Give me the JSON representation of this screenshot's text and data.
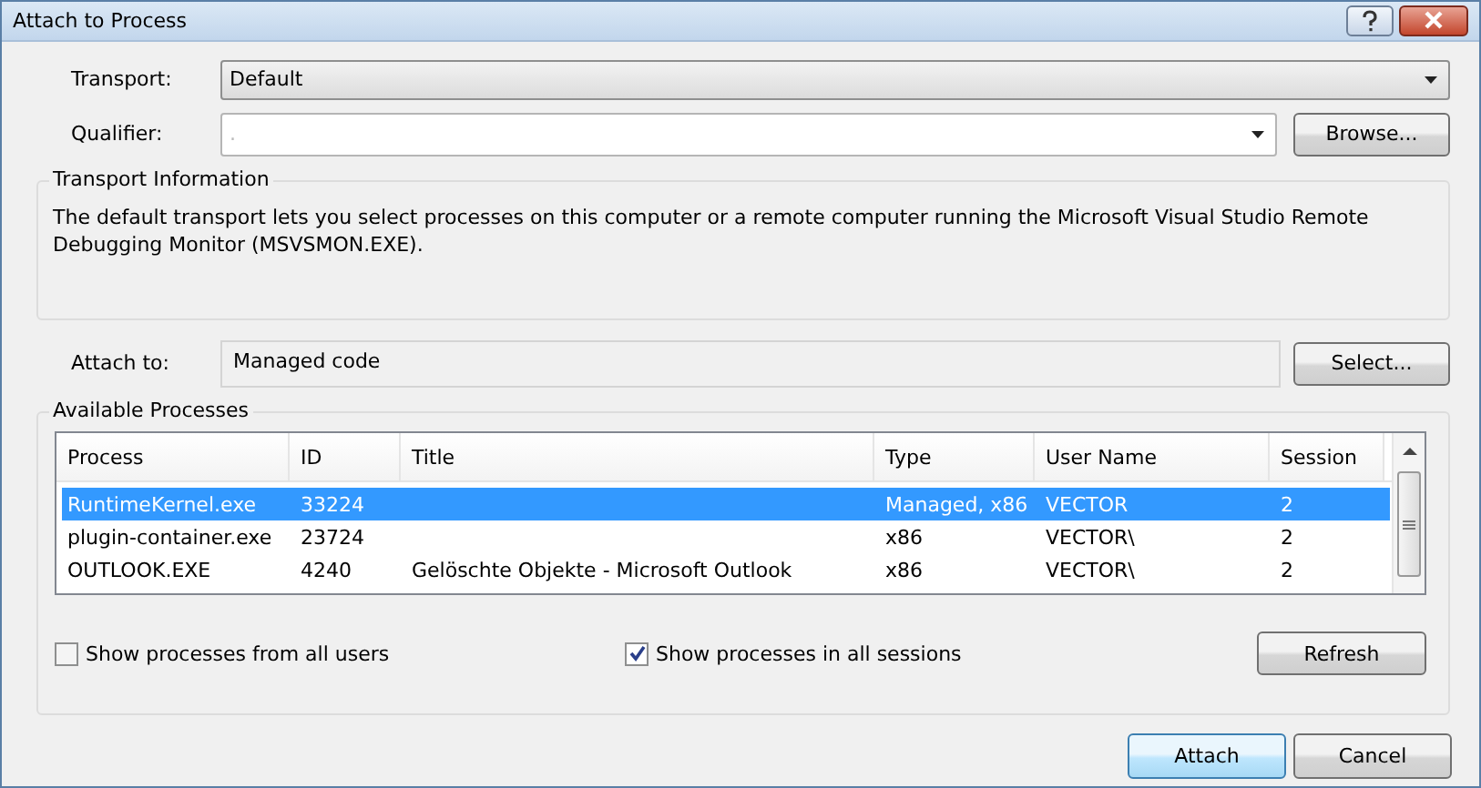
{
  "window": {
    "title": "Attach to Process"
  },
  "transport": {
    "label": "Transport:",
    "value": "Default"
  },
  "qualifier": {
    "label": "Qualifier:",
    "value": ".",
    "button": "Browse..."
  },
  "transport_information": {
    "title": "Transport Information",
    "text": "The default transport lets you select processes on this computer or a remote computer running the Microsoft Visual Studio Remote Debugging Monitor (MSVSMON.EXE)."
  },
  "attach_to": {
    "label": "Attach to:",
    "value": "Managed code",
    "button": "Select..."
  },
  "available_processes": {
    "title": "Available Processes",
    "columns": [
      "Process",
      "ID",
      "Title",
      "Type",
      "User Name",
      "Session"
    ],
    "rows": [
      {
        "cells": [
          "RuntimeKernel.exe",
          "33224",
          "",
          "Managed, x86",
          "VECTOR",
          "2"
        ],
        "selected": true
      },
      {
        "cells": [
          "plugin-container.exe",
          "23724",
          "",
          "x86",
          "VECTOR\\",
          "2"
        ],
        "selected": false
      },
      {
        "cells": [
          "OUTLOOK.EXE",
          "4240",
          "Gelöschte Objekte - Microsoft Outlook",
          "x86",
          "VECTOR\\",
          "2"
        ],
        "selected": false
      }
    ],
    "options": [
      {
        "label": "Show processes from all users",
        "checked": false
      },
      {
        "label": "Show processes in all sessions",
        "checked": true
      }
    ],
    "refresh_button": "Refresh"
  },
  "buttons": [
    {
      "label": "Attach",
      "default": true
    },
    {
      "label": "Cancel",
      "default": false
    }
  ]
}
